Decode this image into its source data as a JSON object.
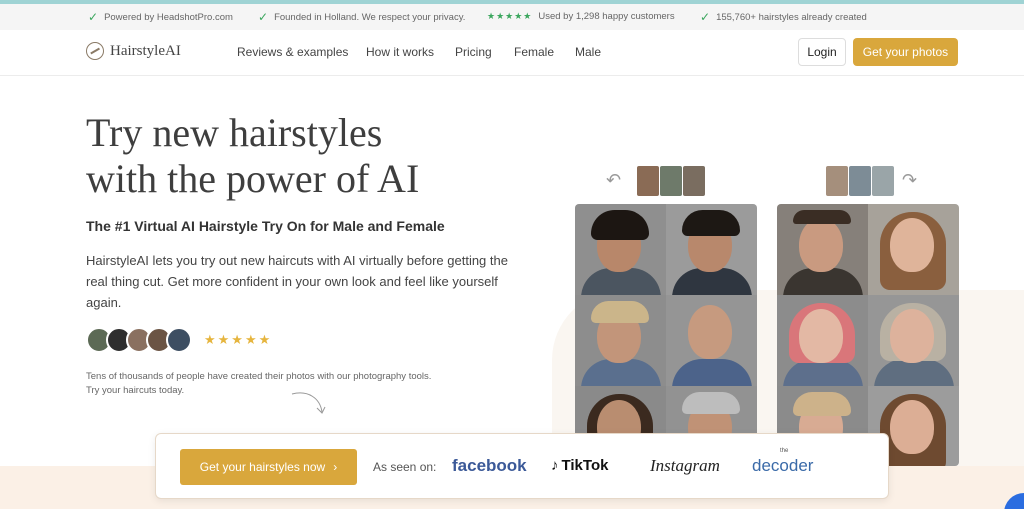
{
  "topbar": {
    "items": [
      "Powered by HeadshotPro.com",
      "Founded in Holland. We respect your privacy.",
      "Used by 1,298 happy customers",
      "155,760+ hairstyles already created"
    ],
    "rating_stars": "★★★★★"
  },
  "nav": {
    "brand": "HairstyleAI",
    "links": [
      "Reviews & examples",
      "How it works",
      "Pricing",
      "Female",
      "Male"
    ],
    "login": "Login",
    "cta": "Get your photos"
  },
  "hero": {
    "title_line1": "Try new hairstyles",
    "title_line2": "with the power of AI",
    "subtitle": "The #1 Virtual AI Hairstyle Try On for Male and Female",
    "description": "HairstyleAI lets you try out new haircuts with AI virtually before getting the real thing cut. Get more confident in your own look and feel like yourself again.",
    "stars": "★★★★★",
    "note": "Tens of thousands of people have created their photos with our photography tools. Try your haircuts today."
  },
  "cta_bar": {
    "button": "Get your hairstyles now",
    "button_chevron": "›",
    "seen_on": "As seen on:",
    "brands": {
      "facebook": "facebook",
      "tiktok": "TikTok",
      "instagram": "Instagram",
      "decoder": "decoder",
      "decoder_small": "the"
    }
  },
  "colors": {
    "accent": "#d9a73c",
    "check": "#3aa65d",
    "star": "#e6b53e"
  }
}
